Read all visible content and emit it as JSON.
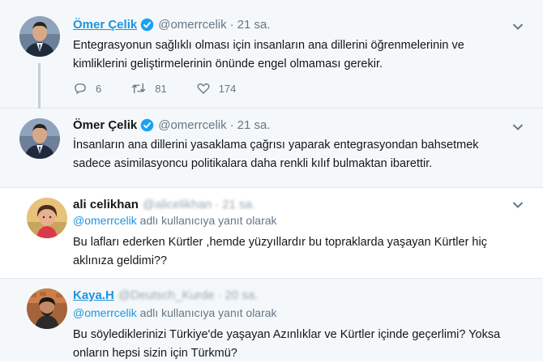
{
  "tweets": [
    {
      "name": "Ömer Çelik",
      "handle": "@omerrcelik",
      "time": "21 sa.",
      "lines": [
        "Entegrasyonun sağlıklı olması için insanların ana dillerini öğrenmelerinin ve",
        "kimliklerini geliştirmelerinin önünde engel olmaması gerekir."
      ],
      "actions": {
        "replies": "6",
        "retweets": "81",
        "likes": "174"
      }
    },
    {
      "name": "Ömer Çelik",
      "handle": "@omerrcelik",
      "time": "21 sa.",
      "lines": [
        "İnsanların ana dillerini yasaklama çağrısı yaparak entegrasyondan bahsetmek",
        "sadece asimilasyoncu politikalara daha renkli kılıf bulmaktan ibarettir."
      ]
    },
    {
      "name": "ali celikhan",
      "handle": "@alicelikhan",
      "time": "21 sa.",
      "reply_mention": "@omerrcelik",
      "reply_suffix": "adlı kullanıcıya yanıt olarak",
      "lines": [
        "Bu lafları ederken Kürtler ,hemde yüzyıllardır bu topraklarda yaşayan Kürtler hiç",
        "aklınıza geldimi??"
      ]
    },
    {
      "name": "Kaya.H",
      "handle": "@Deutsch_Kurde",
      "time": "20 sa.",
      "reply_mention": "@omerrcelik",
      "reply_suffix": "adlı kullanıcıya yanıt olarak",
      "lines": [
        "Bu söylediklerinizi Türkiye'de yaşayan Azınlıklar ve Kürtler içinde geçerlimi? Yoksa",
        "onların hepsi sizin için  Türkmü?"
      ]
    }
  ],
  "separator": "·",
  "colors": {
    "link": "#1b95e0",
    "muted": "#657786",
    "verified": "#1da1f2"
  },
  "icons": [
    "verified-badge-icon",
    "chevron-down-icon",
    "reply-icon",
    "retweet-icon",
    "like-icon"
  ]
}
